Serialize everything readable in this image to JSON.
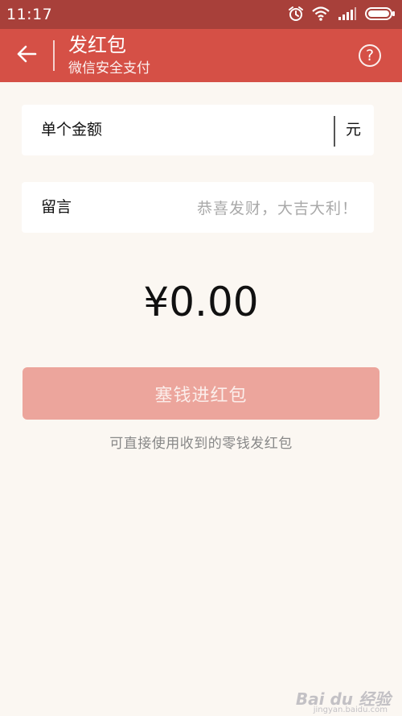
{
  "status_bar": {
    "time": "11:17",
    "icons": [
      "alarm-icon",
      "wifi-icon",
      "signal-icon",
      "battery-icon"
    ]
  },
  "header": {
    "title": "发红包",
    "subtitle": "微信安全支付",
    "back_icon": "back-arrow-icon",
    "help_label": "?"
  },
  "form": {
    "amount": {
      "label": "单个金额",
      "value": "",
      "unit": "元"
    },
    "message": {
      "label": "留言",
      "placeholder": "恭喜发财，大吉大利！",
      "value": ""
    }
  },
  "total": {
    "display": "¥0.00"
  },
  "actions": {
    "submit_label": "塞钱进红包"
  },
  "hint": "可直接使用收到的零钱发红包",
  "watermark": {
    "text": "Bai du 经验",
    "sub": "jingyan.baidu.com"
  },
  "colors": {
    "status_bar": "#A8403A",
    "header": "#D55046",
    "background": "#FBF7F2",
    "button": "#ECA59C"
  }
}
